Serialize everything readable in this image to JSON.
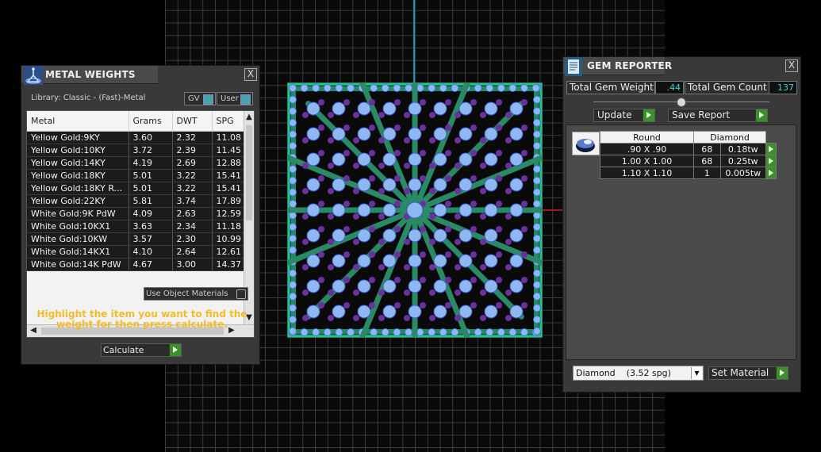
{
  "metal_weights": {
    "title": "METAL WEIGHTS",
    "close": "X",
    "library": "Library: Classic - (Fast)-Metal",
    "toggle_gv": "GV",
    "toggle_user": "User",
    "columns": [
      "Metal",
      "Grams",
      "DWT",
      "SPG"
    ],
    "rows": [
      [
        "Yellow Gold:9KY",
        "3.60",
        "2.32",
        "11.08"
      ],
      [
        "Yellow Gold:10KY",
        "3.72",
        "2.39",
        "11.45"
      ],
      [
        "Yellow Gold:14KY",
        "4.19",
        "2.69",
        "12.88"
      ],
      [
        "Yellow Gold:18KY",
        "5.01",
        "3.22",
        "15.41"
      ],
      [
        "Yellow Gold:18KY R...",
        "5.01",
        "3.22",
        "15.41"
      ],
      [
        "Yellow Gold:22KY",
        "5.81",
        "3.74",
        "17.89"
      ],
      [
        "White Gold:9K PdW",
        "4.09",
        "2.63",
        "12.59"
      ],
      [
        "White Gold:10KX1",
        "3.63",
        "2.34",
        "11.18"
      ],
      [
        "White Gold:10KW",
        "3.57",
        "2.30",
        "10.99"
      ],
      [
        "White Gold:14KX1",
        "4.10",
        "2.64",
        "12.61"
      ],
      [
        "White Gold:14K PdW",
        "4.67",
        "3.00",
        "14.37"
      ]
    ],
    "use_object_materials": "Use Object Materials",
    "instruction": "Highlight the item you want to find the weight for then press calculate.",
    "calculate": "Calculate"
  },
  "gem_reporter": {
    "title": "GEM REPORTER",
    "close": "X",
    "total_weight_label": "Total Gem Weight",
    "total_weight_value": ".44",
    "total_count_label": "Total Gem Count",
    "total_count_value": "137",
    "update": "Update",
    "save_report": "Save Report",
    "table_headers": [
      "Round",
      "Diamond"
    ],
    "rows": [
      [
        ".90 X .90",
        "68",
        "0.18tw"
      ],
      [
        "1.00 X 1.00",
        "68",
        "0.25tw"
      ],
      [
        "1.10 X 1.10",
        "1",
        "0.005tw"
      ]
    ],
    "material_select": "Diamond    (3.52 spg)",
    "set_material": "Set Material"
  },
  "colors": {
    "accent_gold": "#f4bb2a",
    "value_cyan": "#3bd6d0",
    "go_green": "#3c8f2a",
    "gem_blue": "#8fb8f2",
    "gem_purple": "#6b2fa0",
    "metal_green": "#1e8c5e"
  }
}
